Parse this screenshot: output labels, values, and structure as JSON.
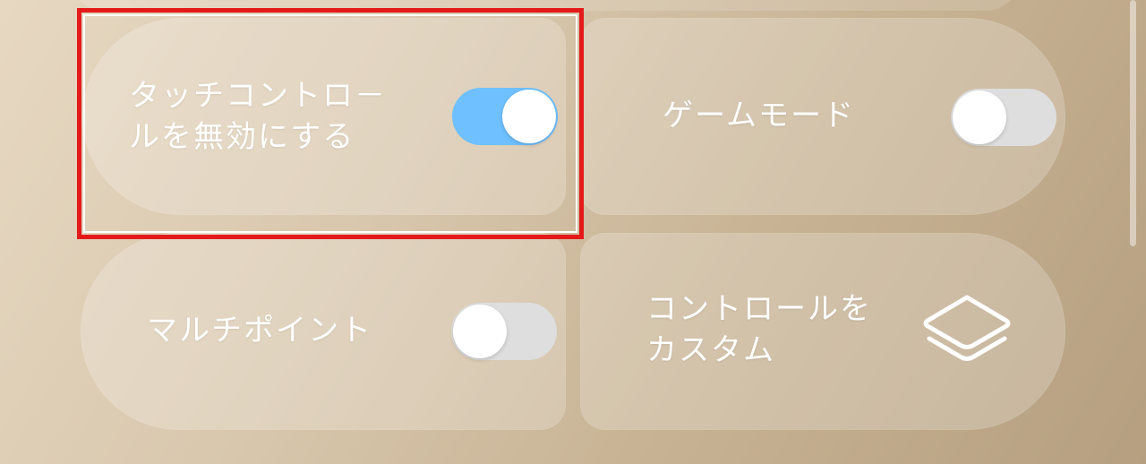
{
  "tiles": {
    "touch_control": {
      "label_line1": "タッチコントロ－",
      "label_line2": "ルを無効にする",
      "toggle_state": "on"
    },
    "game_mode": {
      "label": "ゲームモード",
      "toggle_state": "off"
    },
    "multipoint": {
      "label": "マルチポイント",
      "toggle_state": "off"
    },
    "customize_controls": {
      "label_line1": "コントロールを",
      "label_line2": "カスタム",
      "icon": "layers-icon"
    }
  },
  "colors": {
    "toggle_on": "#6fc0ff",
    "toggle_off": "#dedede",
    "highlight": "#e41a1a"
  }
}
